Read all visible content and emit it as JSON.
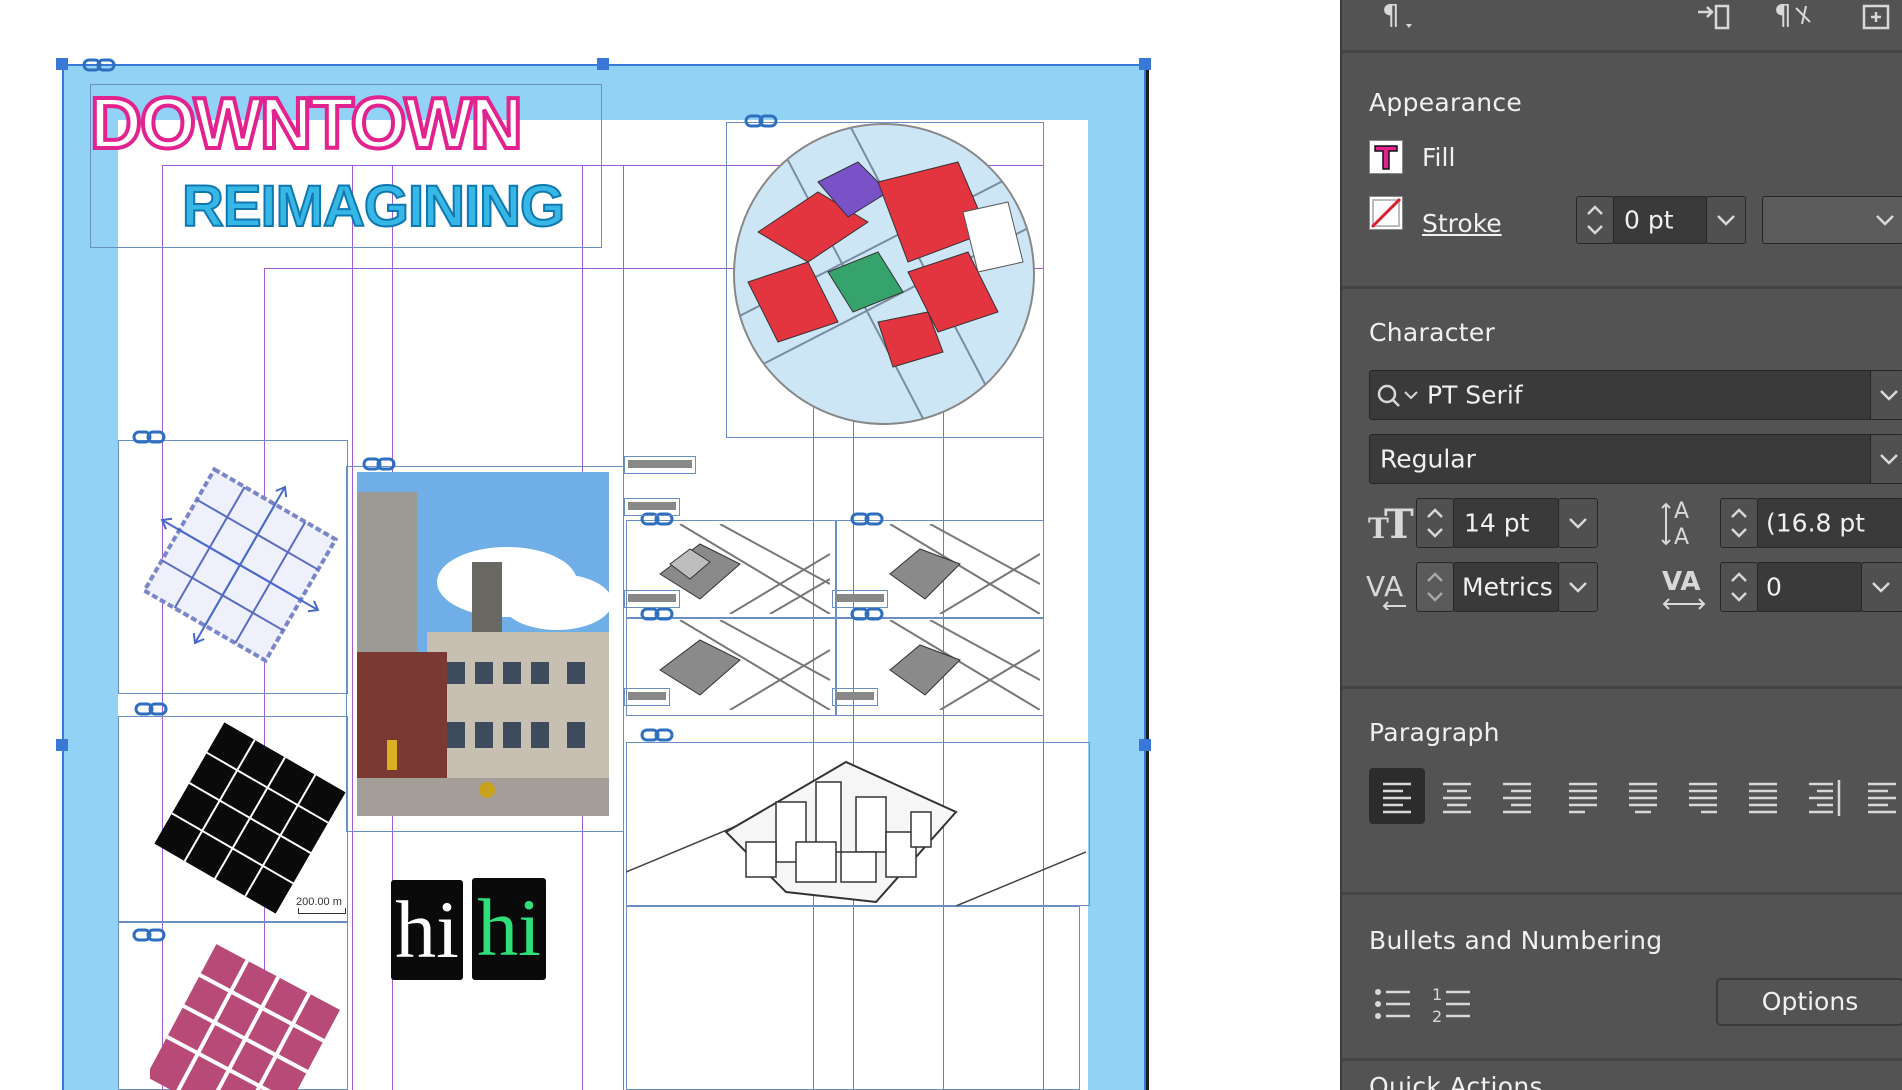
{
  "canvas": {
    "title_line1": "DOWNTOWN",
    "title_line2": "REIMAGINING",
    "scale_label": "200.00 m",
    "hi_left": "hi",
    "hi_right": "hi"
  },
  "panel": {
    "appearance": {
      "heading": "Appearance",
      "fill_label": "Fill",
      "stroke_label": "Stroke",
      "stroke_weight": "0 pt"
    },
    "character": {
      "heading": "Character",
      "font_family": "PT Serif",
      "font_style": "Regular",
      "font_size": "14 pt",
      "leading": "(16.8 pt",
      "kerning": "Metrics",
      "tracking": "0"
    },
    "paragraph": {
      "heading": "Paragraph",
      "alignments": [
        "align-left",
        "align-center",
        "align-right",
        "justify-left",
        "justify-center",
        "justify-right",
        "justify-all",
        "align-towards-spine",
        "align-away-from-spine"
      ],
      "active": "align-left"
    },
    "bullets": {
      "heading": "Bullets and Numbering",
      "options_label": "Options"
    },
    "quick_actions": {
      "heading": "Quick Actions"
    }
  },
  "colors": {
    "fill_swatch": "#e2228e",
    "bleed": "#92d3f5",
    "guide": "#a25bd3",
    "frame": "#6b8fc5",
    "panel_bg": "#535353"
  }
}
